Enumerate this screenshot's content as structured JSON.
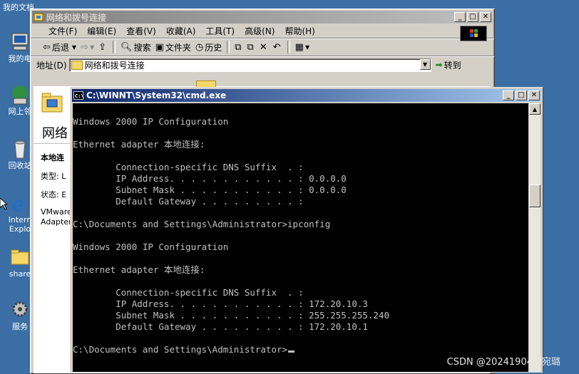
{
  "desktop": {
    "icons": [
      {
        "label": "我的文档",
        "icon": "my-documents-icon"
      },
      {
        "label": "我的电",
        "icon": "my-computer-icon"
      },
      {
        "label": "网上邻",
        "icon": "network-places-icon"
      },
      {
        "label": "回收站",
        "icon": "recycle-bin-icon"
      },
      {
        "label": "Intern",
        "label2": "Explo",
        "icon": "internet-explorer-icon"
      },
      {
        "label": "share",
        "icon": "shared-folder-icon"
      },
      {
        "label": "服务",
        "icon": "services-icon"
      }
    ]
  },
  "explorer": {
    "title": "网络和拨号连接",
    "menu": [
      "文件(F)",
      "编辑(E)",
      "查看(V)",
      "收藏(A)",
      "工具(T)",
      "高级(N)",
      "帮助(H)"
    ],
    "toolbar": {
      "back": "后退",
      "search": "搜索",
      "folders": "文件夹",
      "history": "历史"
    },
    "address_label": "地址(D)",
    "address_value": "网络和拨号连接",
    "go_label": "转到",
    "left_pane": {
      "title": "网络",
      "section": "本地连",
      "type_label": "类型: L",
      "status_label": "状态: E",
      "device_line1": "VMware",
      "device_line2": "Adapter"
    }
  },
  "cmd": {
    "title": "C:\\WINNT\\System32\\cmd.exe",
    "lines": [
      "Windows 2000 IP Configuration",
      "",
      "Ethernet adapter 本地连接:",
      "",
      "        Connection-specific DNS Suffix  . :",
      "        IP Address. . . . . . . . . . . . : 0.0.0.0",
      "        Subnet Mask . . . . . . . . . . . : 0.0.0.0",
      "        Default Gateway . . . . . . . . . :",
      "",
      "C:\\Documents and Settings\\Administrator>ipconfig",
      "",
      "Windows 2000 IP Configuration",
      "",
      "Ethernet adapter 本地连接:",
      "",
      "        Connection-specific DNS Suffix  . :",
      "        IP Address. . . . . . . . . . . . : 172.20.10.3",
      "        Subnet Mask . . . . . . . . . . . : 255.255.255.240",
      "        Default Gateway . . . . . . . . . : 172.20.10.1",
      "",
      "C:\\Documents and Settings\\Administrator>"
    ]
  },
  "watermark": "CSDN @20241904刘宛璐",
  "colors": {
    "desktop": "#3a6ea5",
    "active_title": "#0a246a",
    "console_bg": "#000000",
    "console_fg": "#c0c0c0"
  }
}
